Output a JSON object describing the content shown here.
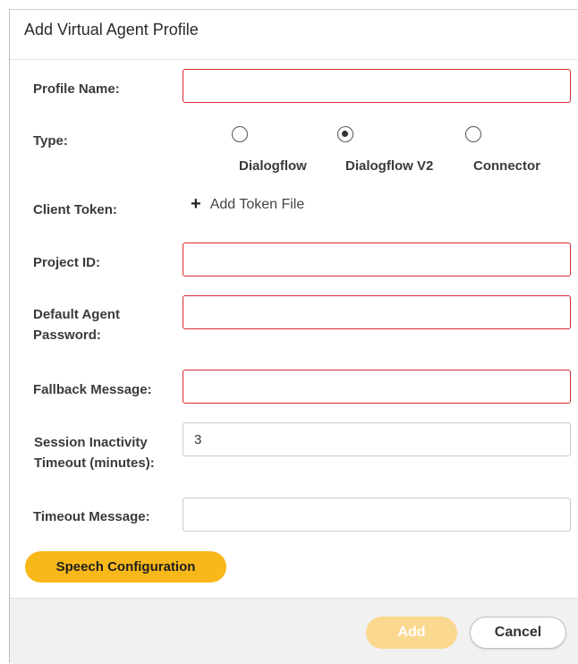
{
  "dialog": {
    "title": "Add Virtual Agent Profile"
  },
  "fields": {
    "profile_name": {
      "label": "Profile Name:",
      "value": ""
    },
    "type": {
      "label": "Type:",
      "options": [
        {
          "label": "Dialogflow",
          "selected": false
        },
        {
          "label": "Dialogflow V2",
          "selected": true
        },
        {
          "label": "Connector",
          "selected": false
        }
      ]
    },
    "client_token": {
      "label": "Client Token:",
      "action_label": "Add Token File",
      "action_icon": "plus-icon"
    },
    "project_id": {
      "label": "Project ID:",
      "value": ""
    },
    "default_agent_password": {
      "label_line1": "Default Agent",
      "label_line2": "Password:",
      "value": ""
    },
    "fallback_message": {
      "label": "Fallback Message:",
      "value": ""
    },
    "session_timeout": {
      "label_line1": "Session Inactivity",
      "label_line2": "Timeout (minutes):",
      "value": "3"
    },
    "timeout_message": {
      "label": "Timeout Message:",
      "value": ""
    }
  },
  "buttons": {
    "speech_configuration": "Speech Configuration",
    "add": "Add",
    "cancel": "Cancel"
  },
  "colors": {
    "accent": "#f9b81a",
    "accent_disabled": "#fbd88f",
    "error_border": "#d7282f"
  }
}
